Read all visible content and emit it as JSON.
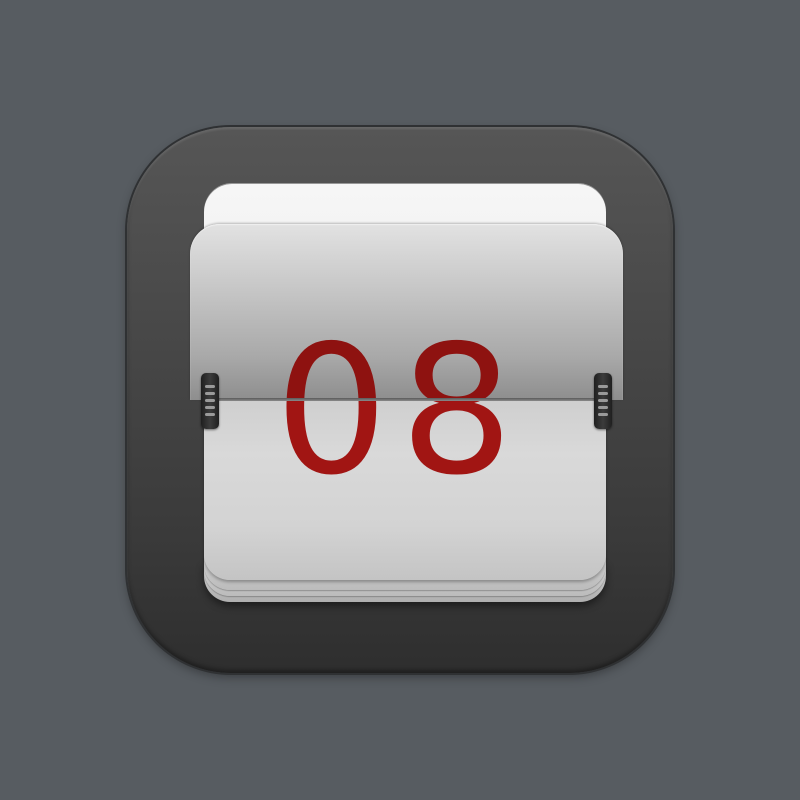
{
  "flip_clock": {
    "display_value": "08"
  }
}
